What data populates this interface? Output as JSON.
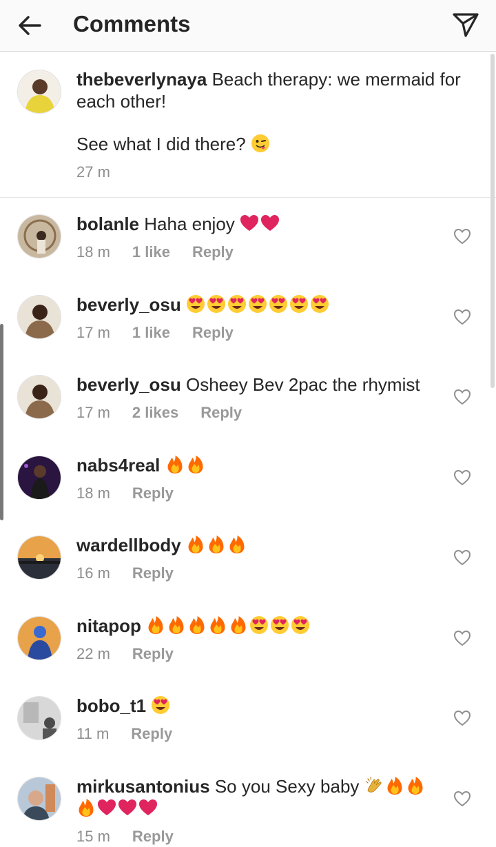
{
  "header": {
    "title": "Comments",
    "back_icon": "arrow-left-icon",
    "send_icon": "paper-plane-icon"
  },
  "caption": {
    "username": "thebeverlynaya",
    "text_line1": "Beach therapy: we mermaid for each other!",
    "text_line2": "See what I did there?",
    "emoji": "winking-tongue-face",
    "time": "27 m"
  },
  "comments": [
    {
      "username": "bolanle",
      "text": "Haha enjoy",
      "emojis": [
        "heart",
        "heart"
      ],
      "time": "18 m",
      "likes": "1 like",
      "reply": "Reply"
    },
    {
      "username": "beverly_osu",
      "text": "",
      "emojis": [
        "heart-eyes",
        "heart-eyes",
        "heart-eyes",
        "heart-eyes",
        "heart-eyes",
        "heart-eyes",
        "heart-eyes"
      ],
      "time": "17 m",
      "likes": "1 like",
      "reply": "Reply"
    },
    {
      "username": "beverly_osu",
      "text": "Osheey Bev 2pac the rhymist",
      "emojis": [],
      "time": "17 m",
      "likes": "2 likes",
      "reply": "Reply"
    },
    {
      "username": "nabs4real",
      "text": "",
      "emojis": [
        "fire",
        "fire"
      ],
      "time": "18 m",
      "likes": "",
      "reply": "Reply"
    },
    {
      "username": "wardellbody",
      "text": "",
      "emojis": [
        "fire",
        "fire",
        "fire"
      ],
      "time": "16 m",
      "likes": "",
      "reply": "Reply"
    },
    {
      "username": "nitapop",
      "text": "",
      "emojis": [
        "fire",
        "fire",
        "fire",
        "fire",
        "fire",
        "heart-eyes",
        "heart-eyes",
        "heart-eyes"
      ],
      "time": "22 m",
      "likes": "",
      "reply": "Reply"
    },
    {
      "username": "bobo_t1",
      "text": "",
      "emojis": [
        "heart-eyes"
      ],
      "time": "11 m",
      "likes": "",
      "reply": "Reply"
    },
    {
      "username": "mirkusantonius",
      "text": "So you Sexy baby",
      "emojis": [
        "clapping-hands",
        "fire",
        "fire",
        "fire",
        "heart",
        "heart",
        "heart"
      ],
      "time": "15 m",
      "likes": "",
      "reply": "Reply"
    }
  ],
  "colors": {
    "text": "#262626",
    "muted": "#8e8e8e",
    "heart": "#e0245e",
    "fire": "#ff7a00",
    "face": "#ffcc33"
  }
}
